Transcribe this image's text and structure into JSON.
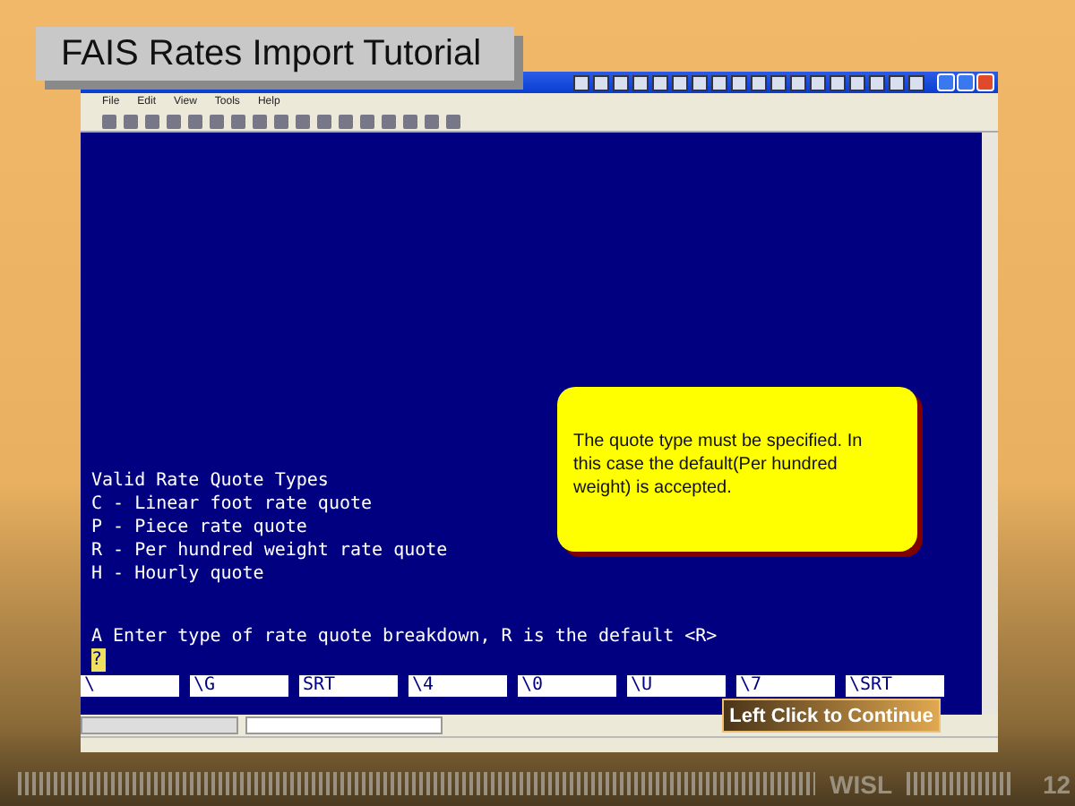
{
  "slide_title": "FAIS Rates Import Tutorial",
  "menu": [
    "File",
    "Edit",
    "View",
    "Tools",
    "Help"
  ],
  "terminal": {
    "lines": [
      "Valid Rate Quote Types",
      "C - Linear foot rate quote",
      "P - Piece rate quote",
      "R - Per hundred weight rate quote",
      "H - Hourly quote"
    ],
    "prompt": "A Enter type of rate quote breakdown, R is the default <R>",
    "input": "?",
    "function_keys": [
      "\\",
      "\\G",
      "SRT",
      "\\4",
      "\\0",
      "\\U",
      "\\7",
      "\\SRT"
    ]
  },
  "callout": "The quote type must be specified. In this case the default(Per hundred weight) is accepted.",
  "continue_button": "Left Click to Continue",
  "footer": {
    "brand": "WISL",
    "page": "12"
  }
}
